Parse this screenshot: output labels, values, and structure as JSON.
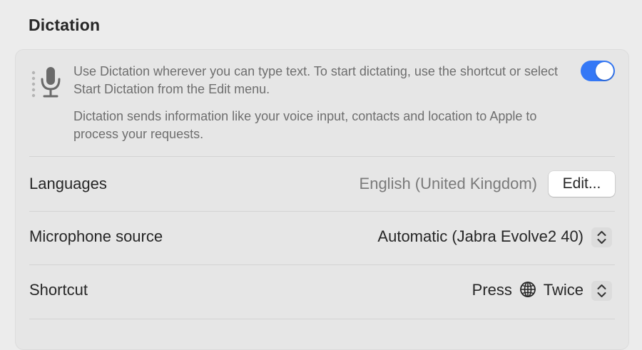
{
  "section": {
    "title": "Dictation"
  },
  "dictation": {
    "description": "Use Dictation wherever you can type text. To start dictating, use the shortcut or select Start Dictation from the Edit menu.",
    "privacy_note": "Dictation sends information like your voice input, contacts and location to Apple to process your requests.",
    "enabled": true,
    "accent_color": "#3478f6"
  },
  "languages": {
    "label": "Languages",
    "value": "English (United Kingdom)",
    "edit_label": "Edit..."
  },
  "microphone": {
    "label": "Microphone source",
    "value": "Automatic (Jabra Evolve2 40)"
  },
  "shortcut": {
    "label": "Shortcut",
    "value_prefix": "Press",
    "value_icon": "globe-icon",
    "value_suffix": "Twice"
  }
}
